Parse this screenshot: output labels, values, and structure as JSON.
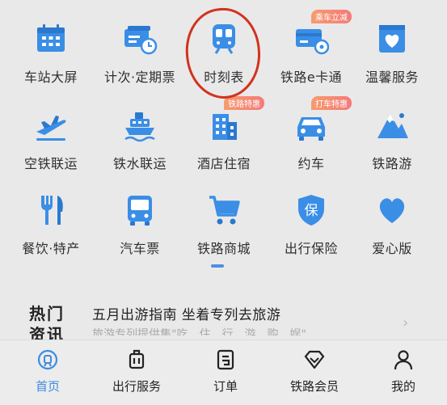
{
  "grid": {
    "items": [
      {
        "label": "车站大屏",
        "icon": "calendar-screen-icon"
      },
      {
        "label": "计次·定期票",
        "icon": "ticket-clock-icon"
      },
      {
        "label": "时刻表",
        "icon": "train-icon"
      },
      {
        "label": "铁路e卡通",
        "icon": "e-card-icon",
        "badge": "乘车立减"
      },
      {
        "label": "温馨服务",
        "icon": "heart-box-icon"
      },
      {
        "label": "空铁联运",
        "icon": "airplane-icon"
      },
      {
        "label": "铁水联运",
        "icon": "ship-icon"
      },
      {
        "label": "酒店住宿",
        "icon": "hotel-icon",
        "badge": "铁路特惠"
      },
      {
        "label": "约车",
        "icon": "car-icon",
        "badge": "打车特惠"
      },
      {
        "label": "铁路游",
        "icon": "mountain-icon"
      },
      {
        "label": "餐饮·特产",
        "icon": "fork-knife-icon"
      },
      {
        "label": "汽车票",
        "icon": "bus-icon"
      },
      {
        "label": "铁路商城",
        "icon": "cart-icon"
      },
      {
        "label": "出行保险",
        "icon": "shield-icon",
        "icon_text": "保"
      },
      {
        "label": "爱心版",
        "icon": "heart-icon"
      }
    ]
  },
  "news": {
    "tag_line1": "热门",
    "tag_line2": "资讯",
    "title": "五月出游指南 坐着专列去旅游",
    "subtitle": "旅游专列提供集\"吃、住、行、游、购、娱\"",
    "arrow": "›"
  },
  "tabbar": {
    "tabs": [
      {
        "label": "首页",
        "icon": "home-icon",
        "active": true
      },
      {
        "label": "出行服务",
        "icon": "luggage-icon"
      },
      {
        "label": "订单",
        "icon": "order-icon"
      },
      {
        "label": "铁路会员",
        "icon": "diamond-icon"
      },
      {
        "label": "我的",
        "icon": "user-icon"
      }
    ]
  },
  "colors": {
    "accent": "#3d8be0",
    "icon_blue": "#3a8ee6",
    "annotation_red": "#d2321e",
    "badge": "#f4856f"
  }
}
